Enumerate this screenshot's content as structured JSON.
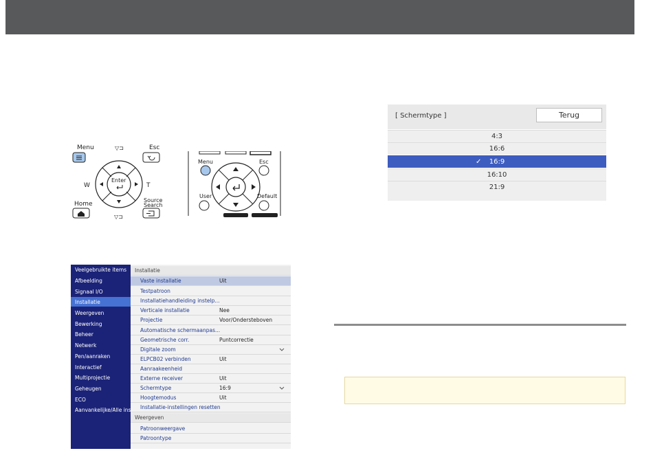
{
  "remote_a": {
    "menu_label": "Menu",
    "esc_label": "Esc",
    "enter_label": "Enter",
    "w_label": "W",
    "t_label": "T",
    "home_label": "Home",
    "source_label_1": "Source",
    "source_label_2": "Search"
  },
  "remote_b": {
    "menu_label": "Menu",
    "esc_label": "Esc",
    "user_label": "User",
    "default_label": "Default"
  },
  "dialog": {
    "title": "[ Schermtype ]",
    "back_label": "Terug",
    "options": [
      {
        "label": "4:3"
      },
      {
        "label": "16:6"
      },
      {
        "label": "16:9",
        "selected": true
      },
      {
        "label": "16:10"
      },
      {
        "label": "21:9"
      }
    ],
    "selected_color": "#3d5cbf"
  },
  "menu": {
    "left_items": [
      "Veelgebruikte items",
      "Afbeelding",
      "Signaal I/O",
      "Installatie",
      "Weergeven",
      "Bewerking",
      "Beheer",
      "Netwerk",
      "Pen/aanraken",
      "Interactief",
      "Multiprojectie",
      "Geheugen",
      "ECO",
      "Aanvankelijke/Alle inst..."
    ],
    "selected_left": "Installatie",
    "section_title": "Installatie",
    "rows": [
      {
        "label": "Vaste installatie",
        "value": "Uit"
      },
      {
        "label": "Testpatroon",
        "value": ""
      },
      {
        "label": "Installatiehandleiding instelp...",
        "value": ""
      },
      {
        "label": "Verticale installatie",
        "value": "Nee"
      },
      {
        "label": "Projectie",
        "value": "Voor/Ondersteboven"
      },
      {
        "label": "Automatische schermaanpas...",
        "value": ""
      },
      {
        "label": "Geometrische corr.",
        "value": "Puntcorrectie"
      },
      {
        "label": "Digitale zoom",
        "value": ""
      },
      {
        "label": "ELPCB02 verbinden",
        "value": "Uit"
      },
      {
        "label": "Aanraakeenheid",
        "value": ""
      },
      {
        "label": "Externe receiver",
        "value": "Uit"
      },
      {
        "label": "Schermtype",
        "value": "16:9"
      },
      {
        "label": "Hoogtemodus",
        "value": "Uit"
      },
      {
        "label": "Installatie-instellingen resetten",
        "value": ""
      }
    ],
    "section2_title": "Weergeven",
    "rows2": [
      {
        "label": "Patroonweergave",
        "value": ""
      },
      {
        "label": "Patroontype",
        "value": ""
      },
      {
        "label": "",
        "value": ""
      }
    ],
    "colors": {
      "left_bg": "#1b2378",
      "left_selected": "#4672d4"
    }
  }
}
